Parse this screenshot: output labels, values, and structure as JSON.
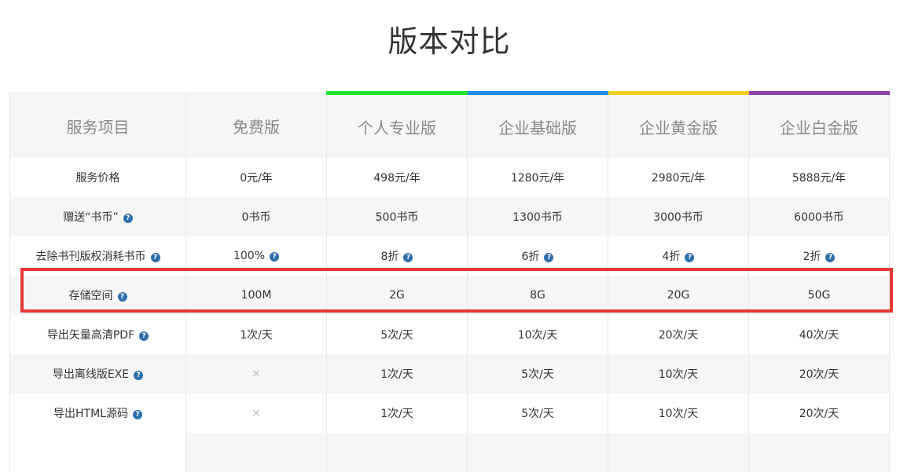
{
  "page": {
    "title": "版本对比"
  },
  "columns": [
    {
      "label": "服务项目",
      "accent": ""
    },
    {
      "label": "免费版",
      "accent": ""
    },
    {
      "label": "个人专业版",
      "accent": "#22e22a"
    },
    {
      "label": "企业基础版",
      "accent": "#1e8fe6"
    },
    {
      "label": "企业黄金版",
      "accent": "#f2d024"
    },
    {
      "label": "企业白金版",
      "accent": "#8e44ad"
    }
  ],
  "rows": [
    {
      "label": "服务价格",
      "help": false,
      "values": [
        "0元/年",
        "498元/年",
        "1280元/年",
        "2980元/年",
        "5888元/年"
      ],
      "cell_help": false
    },
    {
      "label": "赠送“书币”",
      "help": true,
      "values": [
        "0书币",
        "500书币",
        "1300书币",
        "3000书币",
        "6000书币"
      ],
      "cell_help": false
    },
    {
      "label": "去除书刊版权消耗书币",
      "help": true,
      "values": [
        "100%",
        "8折",
        "6折",
        "4折",
        "2折"
      ],
      "cell_help": true
    },
    {
      "label": "存储空间",
      "help": true,
      "values": [
        "100M",
        "2G",
        "8G",
        "20G",
        "50G"
      ],
      "cell_help": false,
      "highlighted": true
    },
    {
      "label": "导出矢量高清PDF",
      "help": true,
      "values": [
        "1次/天",
        "5次/天",
        "10次/天",
        "20次/天",
        "40次/天"
      ],
      "cell_help": false
    },
    {
      "label": "导出离线版EXE",
      "help": true,
      "values": [
        "×",
        "1次/天",
        "5次/天",
        "10次/天",
        "20次/天"
      ],
      "cell_help": false
    },
    {
      "label": "导出HTML源码",
      "help": true,
      "values": [
        "×",
        "1次/天",
        "5次/天",
        "10次/天",
        "20次/天"
      ],
      "cell_help": false
    }
  ],
  "help_glyph": "?",
  "colors": {
    "highlight_border": "#e53935",
    "help_icon": "#2f6fae"
  }
}
